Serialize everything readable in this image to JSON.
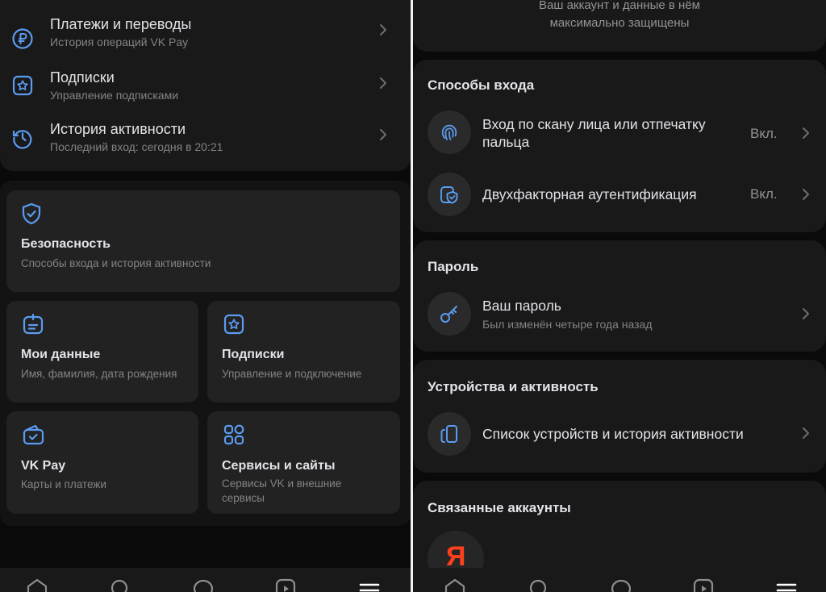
{
  "left": {
    "menu": [
      {
        "title": "Платежи и переводы",
        "subtitle": "История операций VK Pay",
        "icon": "ruble-icon"
      },
      {
        "title": "Подписки",
        "subtitle": "Управление подписками",
        "icon": "star-square-icon"
      },
      {
        "title": "История активности",
        "subtitle": "Последний вход: сегодня в 20:21",
        "icon": "history-icon"
      }
    ],
    "security": {
      "title": "Безопасность",
      "subtitle": "Способы входа и история активности"
    },
    "tiles": [
      {
        "title": "Мои данные",
        "subtitle": "Имя, фамилия, дата рождения"
      },
      {
        "title": "Подписки",
        "subtitle": "Управление и подключение"
      },
      {
        "title": "VK Pay",
        "subtitle": "Карты и платежи"
      },
      {
        "title": "Сервисы и сайты",
        "subtitle": "Сервисы VK и внешние сервисы"
      }
    ]
  },
  "right": {
    "intro_line1": "Ваш аккаунт и данные в нём",
    "intro_line2": "максимально защищены",
    "login_methods": {
      "heading": "Способы входа",
      "items": [
        {
          "title": "Вход по скану лица или отпечатку пальца",
          "value": "Вкл."
        },
        {
          "title": "Двухфакторная аутентификация",
          "value": "Вкл."
        }
      ]
    },
    "password": {
      "heading": "Пароль",
      "title": "Ваш пароль",
      "subtitle": "Был изменён четыре года назад"
    },
    "devices": {
      "heading": "Устройства и активность",
      "title": "Список устройств и история активности"
    },
    "linked": {
      "heading": "Связанные аккаунты",
      "yandex_letter": "Я"
    }
  },
  "colors": {
    "accent": "#5b9bf0",
    "yandex": "#fc3f1d",
    "background": "#0a0a0a",
    "card": "#19191a"
  },
  "tabbar_icons": [
    "home-icon",
    "search-icon",
    "messages-icon",
    "clips-icon",
    "menu-icon"
  ]
}
